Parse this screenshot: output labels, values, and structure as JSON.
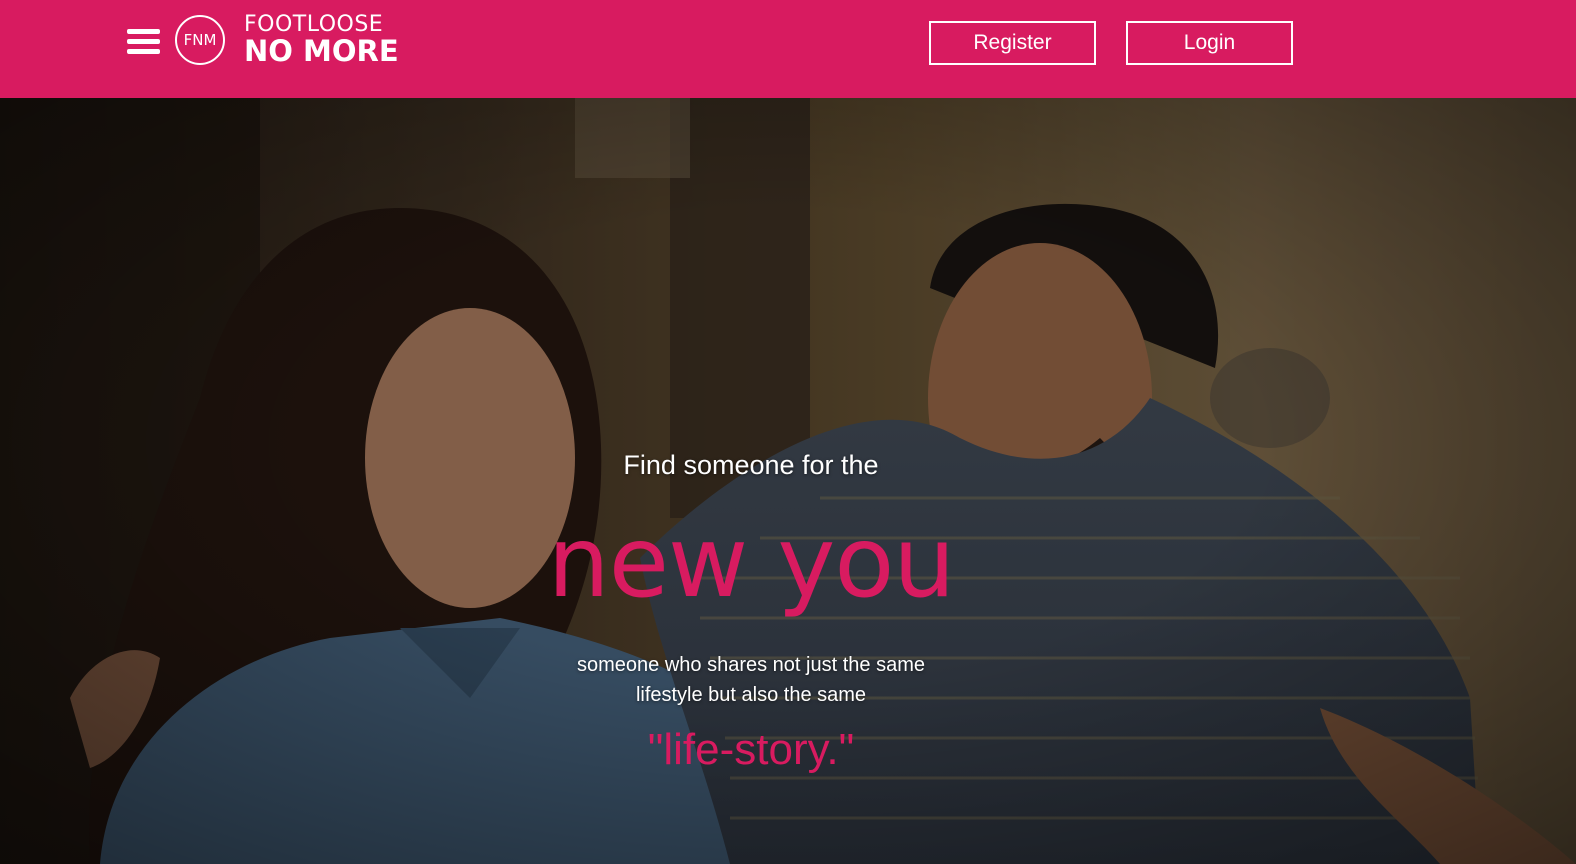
{
  "colors": {
    "brand": "#d81b60",
    "text_light": "#ffffff"
  },
  "header": {
    "menu_icon": "hamburger-menu-icon",
    "logo_monogram": "FNM",
    "brand_line1": "FOOTLOOSE",
    "brand_line2": "NO MORE",
    "register_label": "Register",
    "login_label": "Login"
  },
  "hero": {
    "kicker": "Find someone for the",
    "headline": "new you",
    "sub_line1": "someone who shares not just the same",
    "sub_line2": "lifestyle but also the same",
    "quote": "\"life-story.\""
  }
}
